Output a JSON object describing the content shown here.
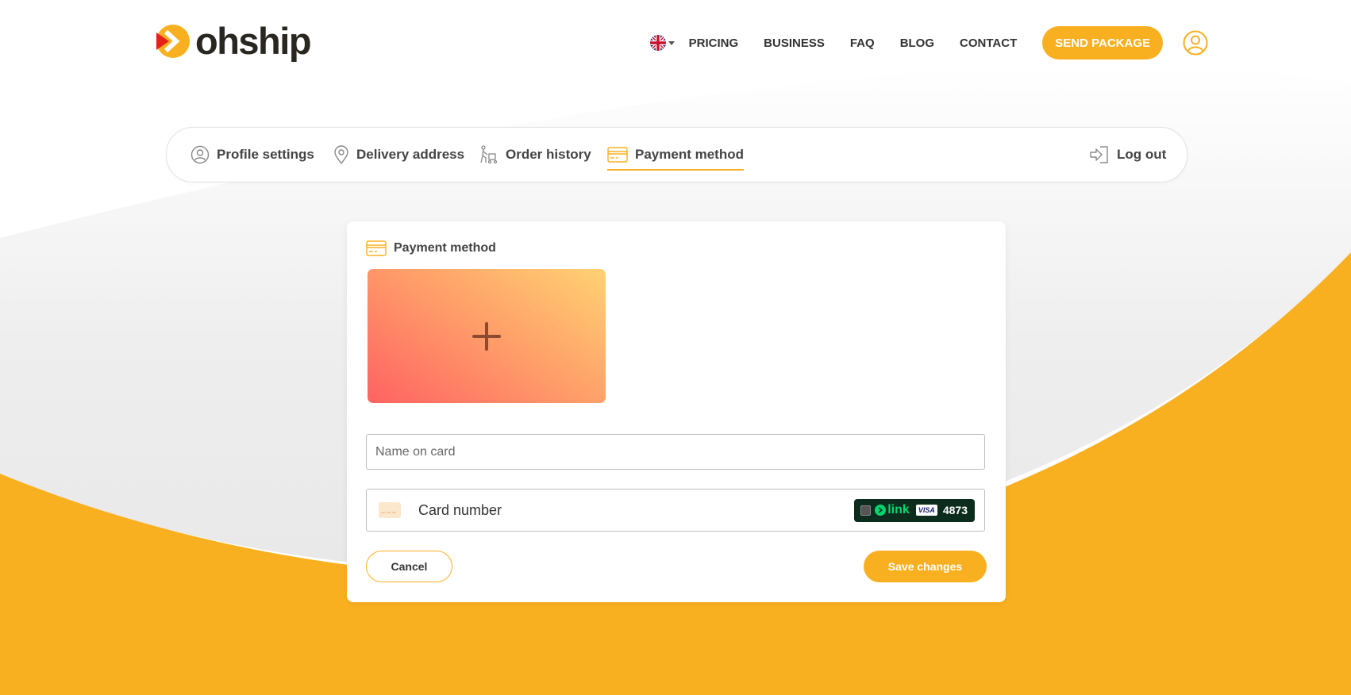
{
  "brand": {
    "name": "ohship",
    "accent": "#f9b020",
    "logo_red": "#e3221b"
  },
  "header": {
    "language_icon": "uk-flag-icon",
    "nav": [
      "PRICING",
      "BUSINESS",
      "FAQ",
      "BLOG",
      "CONTACT"
    ],
    "cta_label": "SEND PACKAGE",
    "user_icon": "user-circle-icon"
  },
  "tabs": [
    {
      "label": "Profile settings",
      "icon": "user-circle-icon"
    },
    {
      "label": "Delivery address",
      "icon": "location-pin-icon"
    },
    {
      "label": "Order history",
      "icon": "courier-icon"
    },
    {
      "label": "Payment method",
      "icon": "credit-card-icon",
      "active": true
    }
  ],
  "logout_label": "Log out",
  "payment": {
    "title": "Payment method",
    "add_card_icon": "plus-icon",
    "name_placeholder": "Name on card",
    "card_number_placeholder": "Card number",
    "link_label": "link",
    "visa_label": "VISA",
    "card_last4": "4873",
    "cancel_label": "Cancel",
    "save_label": "Save changes"
  }
}
